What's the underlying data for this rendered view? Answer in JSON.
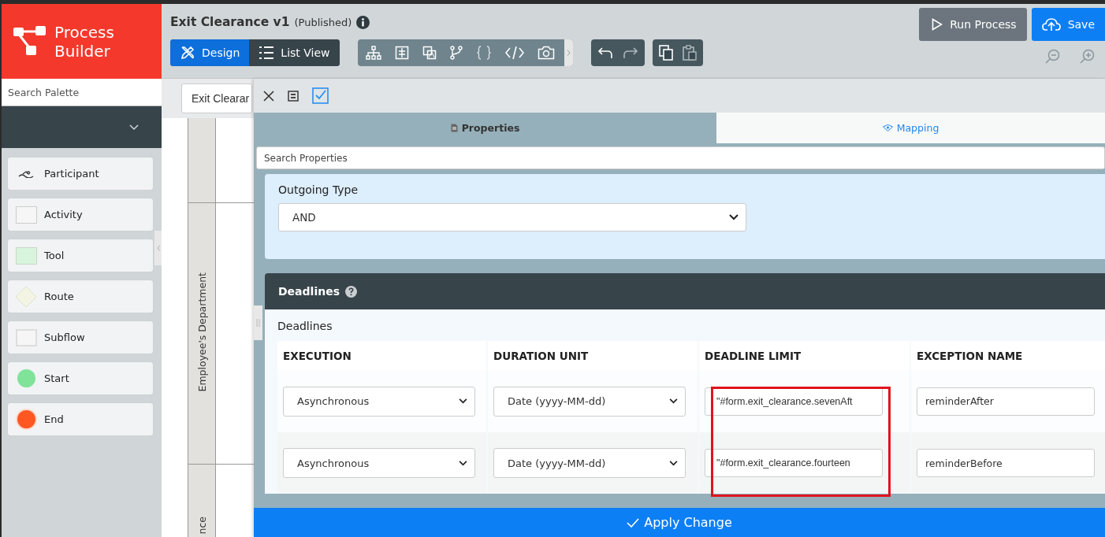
{
  "app": {
    "logo_line1": "Process",
    "logo_line2": "Builder"
  },
  "palette": {
    "search_placeholder": "Search Palette",
    "items": [
      {
        "label": "Participant",
        "kind": "participant"
      },
      {
        "label": "Activity",
        "kind": "activity"
      },
      {
        "label": "Tool",
        "kind": "tool"
      },
      {
        "label": "Route",
        "kind": "route"
      },
      {
        "label": "Subflow",
        "kind": "subflow"
      },
      {
        "label": "Start",
        "kind": "start"
      },
      {
        "label": "End",
        "kind": "end"
      }
    ]
  },
  "header": {
    "title": "Exit Clearance v1",
    "status": "(Published)",
    "view_tabs": [
      {
        "label": "Design",
        "selected": true
      },
      {
        "label": "List View",
        "selected": false
      }
    ],
    "run_button": "Run Process",
    "save_button": "Save"
  },
  "canvas": {
    "tab": "Exit Clearar",
    "lanes": [
      "Employee's Department",
      "nce"
    ]
  },
  "properties_panel": {
    "tabs": [
      {
        "label": "Properties",
        "selected": true
      },
      {
        "label": "Mapping",
        "selected": false
      }
    ],
    "search_placeholder": "Search Properties",
    "outgoing_type": {
      "label": "Outgoing Type",
      "value": "AND"
    },
    "deadlines": {
      "header": "Deadlines",
      "label": "Deadlines",
      "columns": [
        "EXECUTION",
        "DURATION UNIT",
        "DEADLINE LIMIT",
        "EXCEPTION NAME"
      ],
      "rows": [
        {
          "execution": "Asynchronous",
          "duration_unit": "Date (yyyy-MM-dd)",
          "deadline_limit": "\"#form.exit_clearance.sevenAft",
          "exception_name": "reminderAfter"
        },
        {
          "execution": "Asynchronous",
          "duration_unit": "Date (yyyy-MM-dd)",
          "deadline_limit": "\"#form.exit_clearance.fourteen",
          "exception_name": "reminderBefore"
        }
      ]
    },
    "apply_button": "Apply Change"
  }
}
